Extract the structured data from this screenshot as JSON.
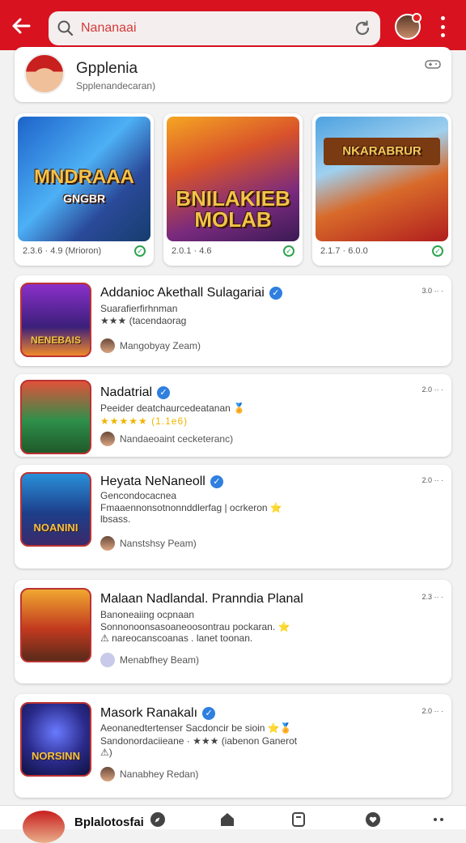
{
  "search": {
    "query": "Nananaai"
  },
  "profile": {
    "title": "Gpplenia",
    "subtitle": "Spplenandecaran)"
  },
  "featured": [
    {
      "art": "MNDRAAA",
      "art_sub": "GNGBR",
      "meta": "2.3.6 · 4.9 (Mrioron)"
    },
    {
      "art": "BNILAKIEB MOLAB",
      "art_sub": "",
      "meta": "2.0.1 · 4.6"
    },
    {
      "art": "NKARABRUR",
      "art_sub": "",
      "meta": "2.1.7 · 6.0.0"
    }
  ],
  "apps": [
    {
      "name": "Addanioc Akethall Sulagariai",
      "line1": "Suarafierfirhnman",
      "line2": "★★★  (tacendaorag",
      "dev": "Mangobyay Zeam)",
      "side": "3.0 ·· ·",
      "art": "NENEBAIS"
    },
    {
      "name": "Nadatrial",
      "line1": "Peeider deatchaurcedeatanan 🏅",
      "line2": "★★★★★  (1.1e6)",
      "dev": "Nandaeoaint cecketeranc)",
      "side": "2.0 ·· ·",
      "art": ""
    },
    {
      "name": "Heyata NeNaneoll",
      "line1": "Gencondocacnea",
      "line2": "Fmaaennonsotnonnddlerfag | ocrkeron ⭐ lbsass.",
      "dev": "Nanstshsy Peam)",
      "side": "2.0 ·· ·",
      "art": "NOANINI"
    },
    {
      "name": "Malaan Nadlandal. Pranndia Planal",
      "line1": "Banoneaiing ocpnaan",
      "line2": "Sonnonoonsasoaneoosontrau pockaran. ⭐ ⚠ nareocanscoanas . lanet toonan.",
      "dev": "Menabfhey Beam)",
      "side": "2.3 ·· ·",
      "art": ""
    },
    {
      "name": "Masork Ranakalı",
      "line1": "Aeonanedtertenser Sacdoncir be sioin ⭐🏅",
      "line2": "Sandonordaciieane · ★★★  (iabenon Ganerot ⚠)",
      "dev": "Nanabhey Redan)",
      "side": "2.0 ·· ·",
      "art": "NORSINN"
    }
  ],
  "bottom": {
    "label": "Bplalotosfai"
  }
}
